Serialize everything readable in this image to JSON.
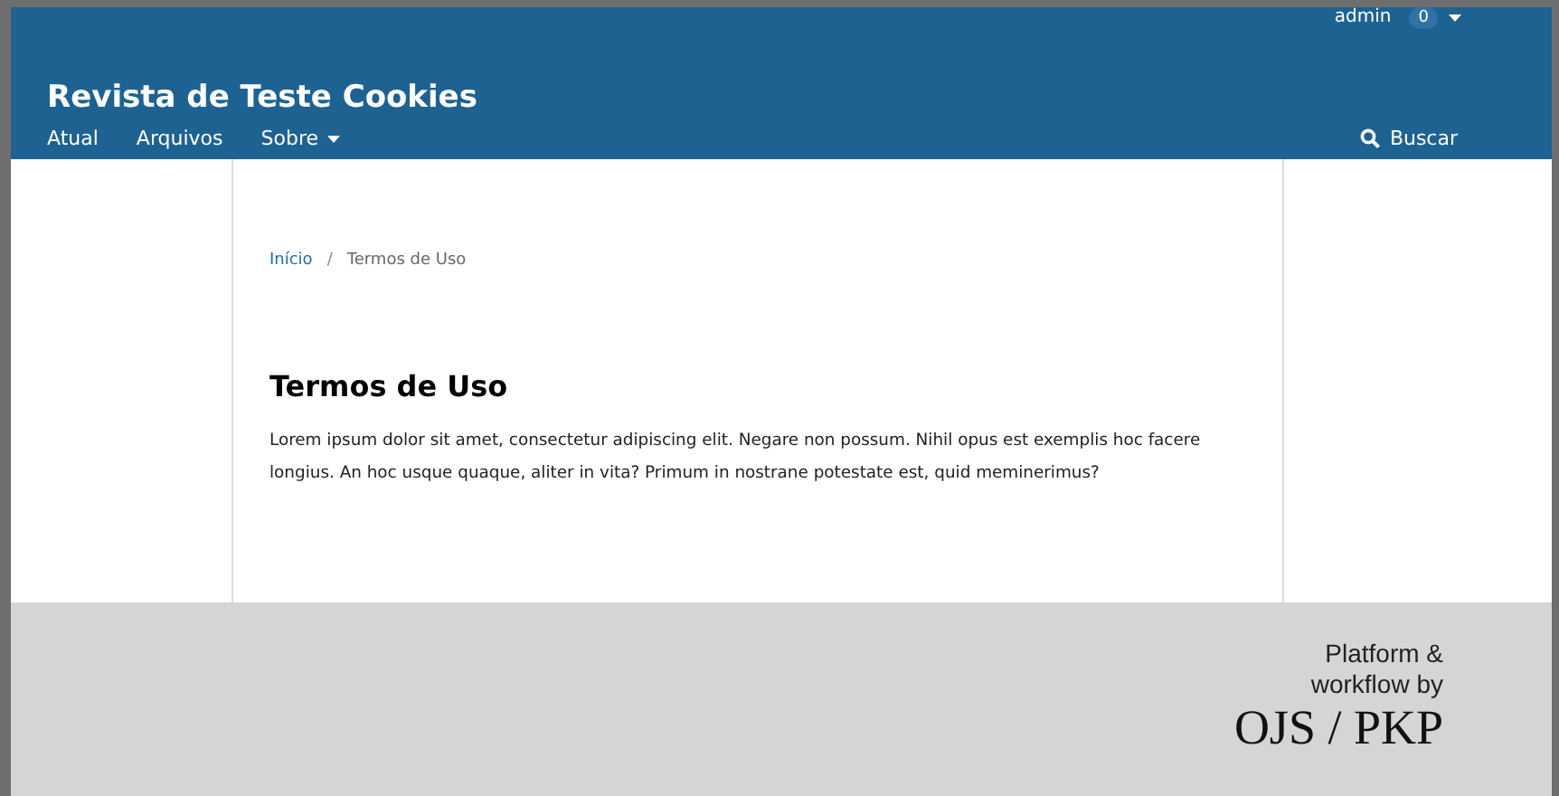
{
  "user_nav": {
    "username": "admin",
    "badge": "0"
  },
  "site_title": "Revista de Teste Cookies",
  "nav": [
    {
      "label": "Atual",
      "dropdown": false
    },
    {
      "label": "Arquivos",
      "dropdown": false
    },
    {
      "label": "Sobre",
      "dropdown": true
    }
  ],
  "search": {
    "label": "Buscar"
  },
  "breadcrumb_separator": "/",
  "breadcrumbs": [
    {
      "label": "Início",
      "link": true
    },
    {
      "label": "Termos de Uso",
      "link": false
    }
  ],
  "page_title": "Termos de Uso",
  "body": "Lorem ipsum dolor sit amet, consectetur adipiscing elit. Negare non possum. Nihil opus est exemplis hoc facere longius. An hoc usque quaque, aliter in vita? Primum in nostrane potestate est, quid meminerimus?",
  "footer": {
    "caption_line_1": "Platform &",
    "caption_line_2": "workflow by",
    "logo": "OJS / PKP"
  }
}
